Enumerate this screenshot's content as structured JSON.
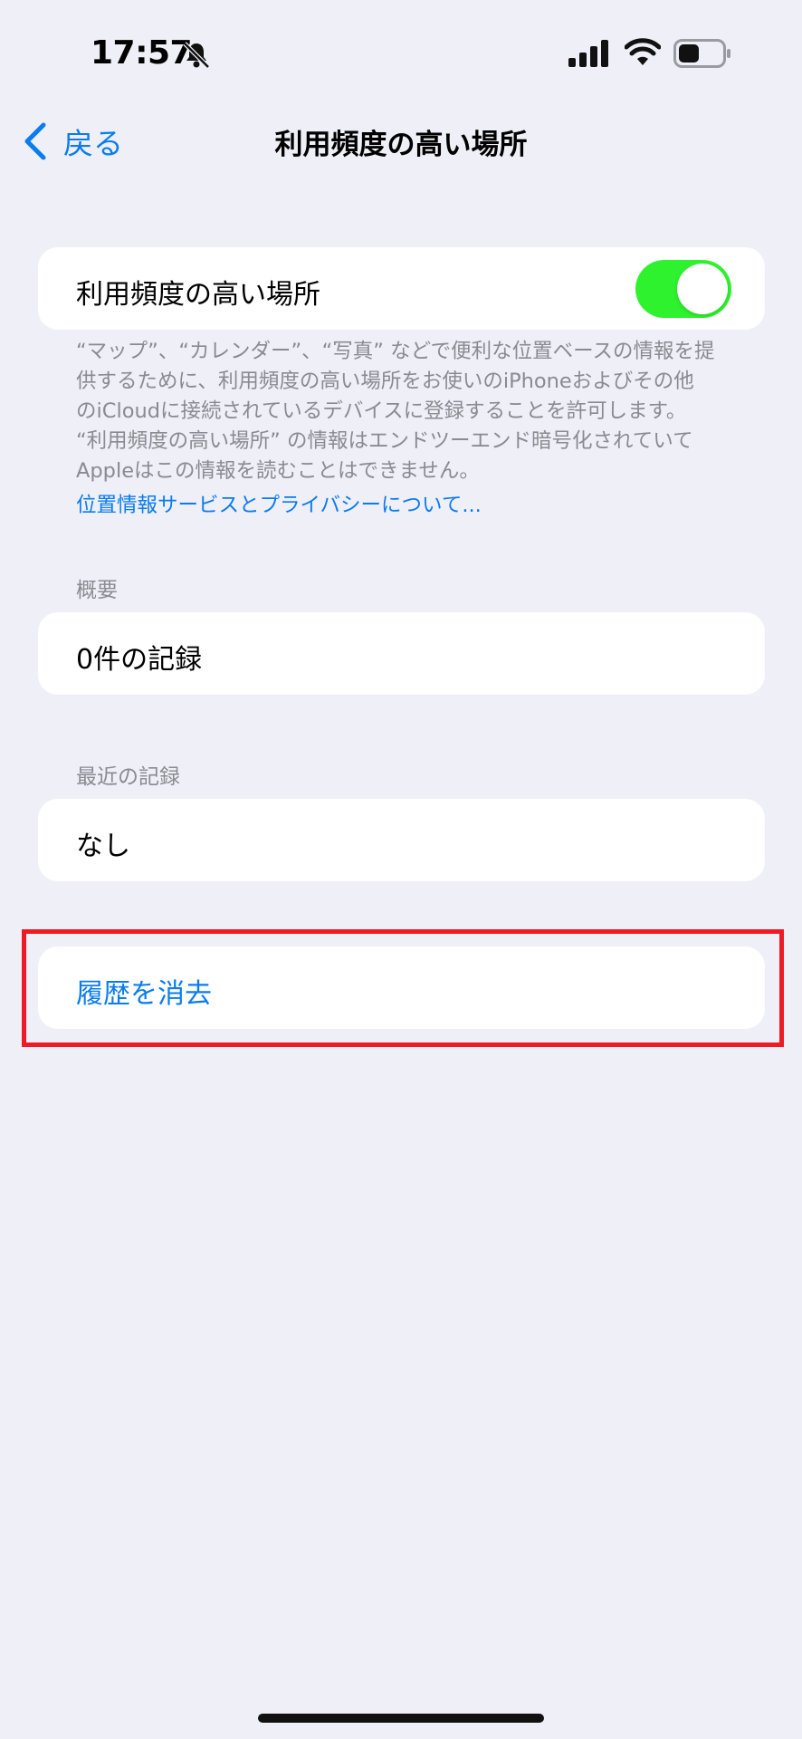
{
  "status_bar": {
    "time": "17:57",
    "icons": [
      "bell-slash-icon",
      "cellular-signal-icon",
      "wifi-icon",
      "battery-icon"
    ]
  },
  "nav": {
    "back_label": "戻る",
    "title": "利用頻度の高い場所"
  },
  "significant_locations": {
    "label": "利用頻度の高い場所",
    "toggle_on": true,
    "description_lines": [
      "“マップ”、“カレンダー”、“写真” などで便利な位置ベースの情報を提",
      "供するために、利用頻度の高い場所をお使いのiPhoneおよびその他",
      "のiCloudに接続されているデバイスに登録することを許可します。",
      "“利用頻度の高い場所” の情報はエンドツーエンド暗号化されていて",
      "Appleはこの情報を読むことはできません。"
    ],
    "privacy_link": "位置情報サービスとプライバシーについて..."
  },
  "summary": {
    "header": "概要",
    "value": "0件の記録"
  },
  "recent": {
    "header": "最近の記録",
    "value": "なし"
  },
  "clear_history": {
    "label": "履歴を消去"
  },
  "colors": {
    "accent": "#0a7cf0",
    "toggle_on": "#2ef22e",
    "highlight_border": "#ee1b24",
    "background": "#efeff7"
  }
}
